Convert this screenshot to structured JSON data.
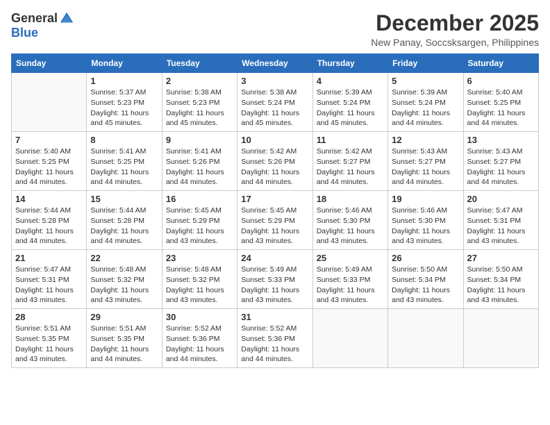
{
  "logo": {
    "text_general": "General",
    "text_blue": "Blue"
  },
  "header": {
    "month": "December 2025",
    "location": "New Panay, Soccsksargen, Philippines"
  },
  "days_of_week": [
    "Sunday",
    "Monday",
    "Tuesday",
    "Wednesday",
    "Thursday",
    "Friday",
    "Saturday"
  ],
  "weeks": [
    [
      {
        "day": "",
        "info": ""
      },
      {
        "day": "1",
        "info": "Sunrise: 5:37 AM\nSunset: 5:23 PM\nDaylight: 11 hours\nand 45 minutes."
      },
      {
        "day": "2",
        "info": "Sunrise: 5:38 AM\nSunset: 5:23 PM\nDaylight: 11 hours\nand 45 minutes."
      },
      {
        "day": "3",
        "info": "Sunrise: 5:38 AM\nSunset: 5:24 PM\nDaylight: 11 hours\nand 45 minutes."
      },
      {
        "day": "4",
        "info": "Sunrise: 5:39 AM\nSunset: 5:24 PM\nDaylight: 11 hours\nand 45 minutes."
      },
      {
        "day": "5",
        "info": "Sunrise: 5:39 AM\nSunset: 5:24 PM\nDaylight: 11 hours\nand 44 minutes."
      },
      {
        "day": "6",
        "info": "Sunrise: 5:40 AM\nSunset: 5:25 PM\nDaylight: 11 hours\nand 44 minutes."
      }
    ],
    [
      {
        "day": "7",
        "info": "Sunrise: 5:40 AM\nSunset: 5:25 PM\nDaylight: 11 hours\nand 44 minutes."
      },
      {
        "day": "8",
        "info": "Sunrise: 5:41 AM\nSunset: 5:25 PM\nDaylight: 11 hours\nand 44 minutes."
      },
      {
        "day": "9",
        "info": "Sunrise: 5:41 AM\nSunset: 5:26 PM\nDaylight: 11 hours\nand 44 minutes."
      },
      {
        "day": "10",
        "info": "Sunrise: 5:42 AM\nSunset: 5:26 PM\nDaylight: 11 hours\nand 44 minutes."
      },
      {
        "day": "11",
        "info": "Sunrise: 5:42 AM\nSunset: 5:27 PM\nDaylight: 11 hours\nand 44 minutes."
      },
      {
        "day": "12",
        "info": "Sunrise: 5:43 AM\nSunset: 5:27 PM\nDaylight: 11 hours\nand 44 minutes."
      },
      {
        "day": "13",
        "info": "Sunrise: 5:43 AM\nSunset: 5:27 PM\nDaylight: 11 hours\nand 44 minutes."
      }
    ],
    [
      {
        "day": "14",
        "info": "Sunrise: 5:44 AM\nSunset: 5:28 PM\nDaylight: 11 hours\nand 44 minutes."
      },
      {
        "day": "15",
        "info": "Sunrise: 5:44 AM\nSunset: 5:28 PM\nDaylight: 11 hours\nand 44 minutes."
      },
      {
        "day": "16",
        "info": "Sunrise: 5:45 AM\nSunset: 5:29 PM\nDaylight: 11 hours\nand 43 minutes."
      },
      {
        "day": "17",
        "info": "Sunrise: 5:45 AM\nSunset: 5:29 PM\nDaylight: 11 hours\nand 43 minutes."
      },
      {
        "day": "18",
        "info": "Sunrise: 5:46 AM\nSunset: 5:30 PM\nDaylight: 11 hours\nand 43 minutes."
      },
      {
        "day": "19",
        "info": "Sunrise: 5:46 AM\nSunset: 5:30 PM\nDaylight: 11 hours\nand 43 minutes."
      },
      {
        "day": "20",
        "info": "Sunrise: 5:47 AM\nSunset: 5:31 PM\nDaylight: 11 hours\nand 43 minutes."
      }
    ],
    [
      {
        "day": "21",
        "info": "Sunrise: 5:47 AM\nSunset: 5:31 PM\nDaylight: 11 hours\nand 43 minutes."
      },
      {
        "day": "22",
        "info": "Sunrise: 5:48 AM\nSunset: 5:32 PM\nDaylight: 11 hours\nand 43 minutes."
      },
      {
        "day": "23",
        "info": "Sunrise: 5:48 AM\nSunset: 5:32 PM\nDaylight: 11 hours\nand 43 minutes."
      },
      {
        "day": "24",
        "info": "Sunrise: 5:49 AM\nSunset: 5:33 PM\nDaylight: 11 hours\nand 43 minutes."
      },
      {
        "day": "25",
        "info": "Sunrise: 5:49 AM\nSunset: 5:33 PM\nDaylight: 11 hours\nand 43 minutes."
      },
      {
        "day": "26",
        "info": "Sunrise: 5:50 AM\nSunset: 5:34 PM\nDaylight: 11 hours\nand 43 minutes."
      },
      {
        "day": "27",
        "info": "Sunrise: 5:50 AM\nSunset: 5:34 PM\nDaylight: 11 hours\nand 43 minutes."
      }
    ],
    [
      {
        "day": "28",
        "info": "Sunrise: 5:51 AM\nSunset: 5:35 PM\nDaylight: 11 hours\nand 43 minutes."
      },
      {
        "day": "29",
        "info": "Sunrise: 5:51 AM\nSunset: 5:35 PM\nDaylight: 11 hours\nand 44 minutes."
      },
      {
        "day": "30",
        "info": "Sunrise: 5:52 AM\nSunset: 5:36 PM\nDaylight: 11 hours\nand 44 minutes."
      },
      {
        "day": "31",
        "info": "Sunrise: 5:52 AM\nSunset: 5:36 PM\nDaylight: 11 hours\nand 44 minutes."
      },
      {
        "day": "",
        "info": ""
      },
      {
        "day": "",
        "info": ""
      },
      {
        "day": "",
        "info": ""
      }
    ]
  ]
}
